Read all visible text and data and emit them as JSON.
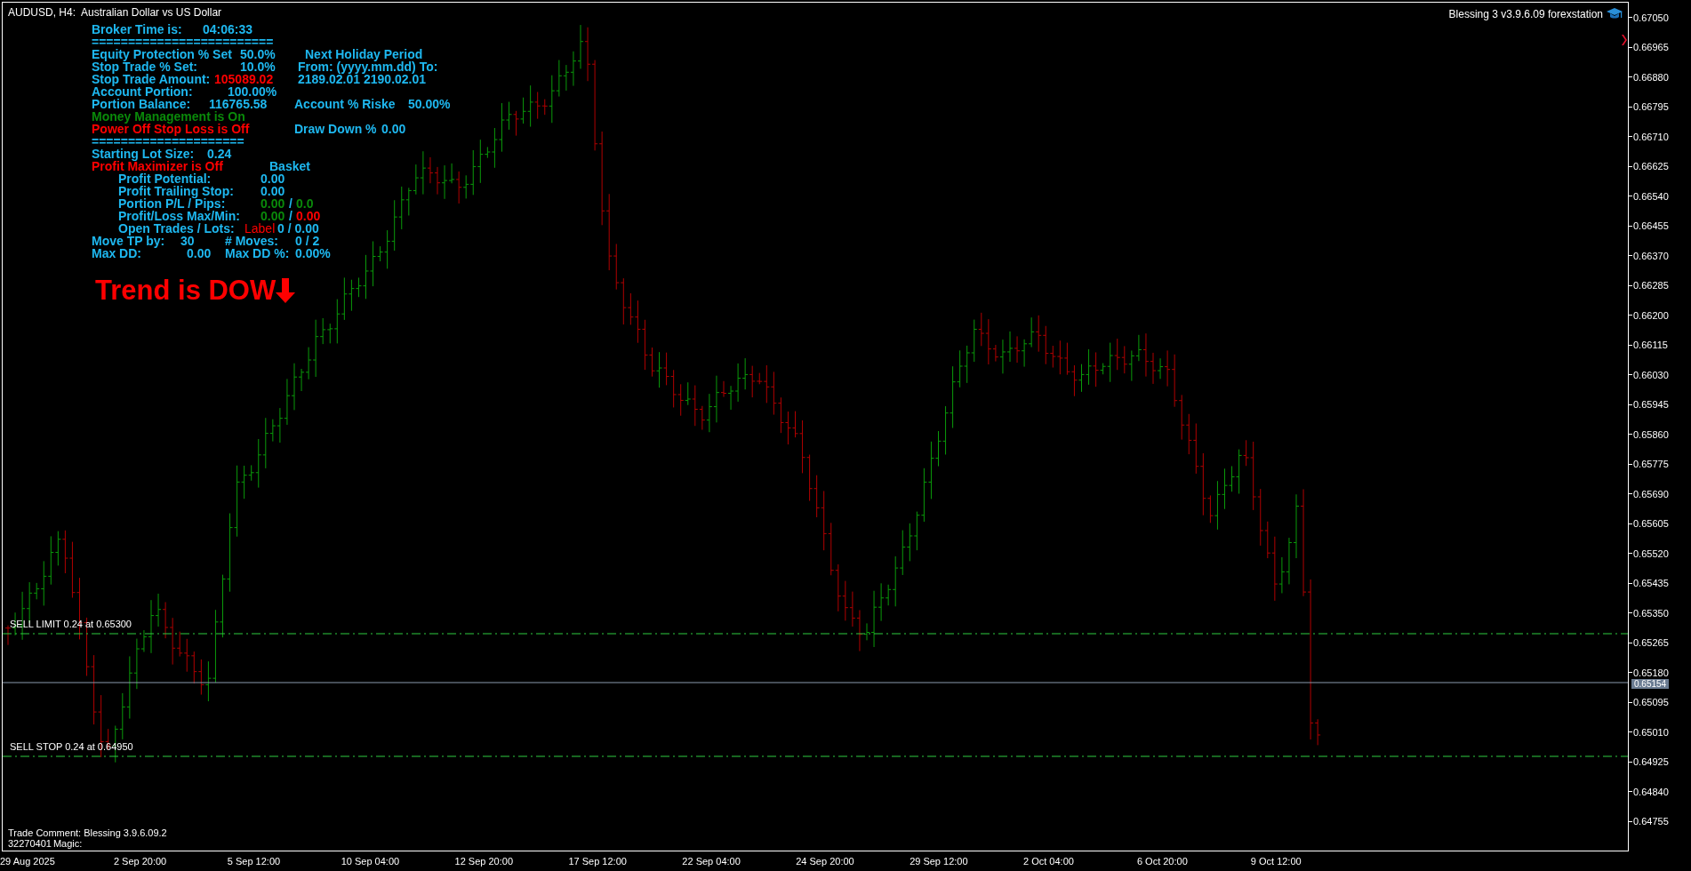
{
  "chart": {
    "symbol_title": "AUDUSD, H4:  Australian Dollar vs US Dollar",
    "expert_title": "Blessing 3 v3.9.6.09 forexstation",
    "price_axis": [
      "0.67050",
      "0.66965",
      "0.66880",
      "0.66795",
      "0.66710",
      "0.66625",
      "0.66540",
      "0.66455",
      "0.66370",
      "0.66285",
      "0.66200",
      "0.66115",
      "0.66030",
      "0.65945",
      "0.65860",
      "0.65775",
      "0.65690",
      "0.65605",
      "0.65520",
      "0.65435",
      "0.65350",
      "0.65265",
      "0.65180",
      "0.65095",
      "0.65010",
      "0.64925",
      "0.64840",
      "0.64755"
    ],
    "current_price": "0.65154",
    "time_axis": [
      "29 Aug 2025",
      "2 Sep 20:00",
      "5 Sep 12:00",
      "10 Sep 04:00",
      "12 Sep 20:00",
      "17 Sep 12:00",
      "22 Sep 04:00",
      "24 Sep 20:00",
      "29 Sep 12:00",
      "2 Oct 04:00",
      "6 Oct 20:00",
      "9 Oct 12:00"
    ],
    "orders": [
      {
        "label": "SELL LIMIT 0.24 at 0.65300"
      },
      {
        "label": "SELL STOP 0.24 at 0.64950"
      }
    ],
    "comment": "Trade Comment: Blessing 3.9.6.09.2",
    "magic_number": "32270401",
    "magic_label": "Magic:"
  },
  "panel": {
    "lines": [
      [
        {
          "text": "Broker Time is:",
          "color": "#1eb8f0",
          "kind": "bold"
        },
        {
          "text": "04:06:33",
          "color": "#1eb8f0",
          "kind": "bold"
        }
      ],
      [
        {
          "text": "=========================",
          "color": "#1eb8f0",
          "kind": "bold"
        }
      ],
      [
        {
          "text": "Equity Protection % Set",
          "color": "#1eb8f0",
          "kind": "bold"
        },
        {
          "text": "50.0%",
          "color": "#1eb8f0",
          "kind": "bold"
        },
        {
          "text": "Next Holiday Period",
          "color": "#1eb8f0",
          "kind": "bold"
        }
      ],
      [
        {
          "text": "Stop Trade % Set:",
          "color": "#1eb8f0",
          "kind": "bold"
        },
        {
          "text": "10.0%",
          "color": "#1eb8f0",
          "kind": "bold"
        },
        {
          "text": "From: (yyyy.mm.dd) To:",
          "color": "#1eb8f0",
          "kind": "bold"
        }
      ],
      [
        {
          "text": "Stop Trade Amount:",
          "color": "#1eb8f0",
          "kind": "bold"
        },
        {
          "text": "105089.02",
          "color": "#ff0000",
          "kind": "bold"
        },
        {
          "text": "2189.02.01",
          "color": "#1eb8f0",
          "kind": "bold"
        },
        {
          "text": "2190.02.01",
          "color": "#1eb8f0",
          "kind": "bold"
        }
      ],
      [
        {
          "text": "Account Portion:",
          "color": "#1eb8f0",
          "kind": "bold"
        },
        {
          "text": "100.00%",
          "color": "#1eb8f0",
          "kind": "bold"
        }
      ],
      [
        {
          "text": "Portion Balance:",
          "color": "#1eb8f0",
          "kind": "bold"
        },
        {
          "text": "116765.58",
          "color": "#1eb8f0",
          "kind": "bold"
        },
        {
          "text": "Account % Riske",
          "color": "#1eb8f0",
          "kind": "bold"
        },
        {
          "text": "50.00%",
          "color": "#1eb8f0",
          "kind": "bold"
        }
      ],
      [
        {
          "text": "Money Management is On",
          "color": "#0a8a0a",
          "kind": "bold"
        }
      ],
      [
        {
          "text": "Power Off Stop Loss is Off",
          "color": "#ff0000",
          "kind": "bold"
        },
        {
          "text": "Draw Down %",
          "color": "#1eb8f0",
          "kind": "bold"
        },
        {
          "text": "0.00",
          "color": "#1eb8f0",
          "kind": "bold"
        }
      ],
      [
        {
          "text": "=====================",
          "color": "#1eb8f0",
          "kind": "bold"
        }
      ],
      [
        {
          "text": "Starting Lot Size:",
          "color": "#1eb8f0",
          "kind": "bold"
        },
        {
          "text": "0.24",
          "color": "#1eb8f0",
          "kind": "bold"
        }
      ],
      [
        {
          "text": "Profit Maximizer is Off",
          "color": "#ff0000",
          "kind": "bold"
        },
        {
          "text": "Basket",
          "color": "#1eb8f0",
          "kind": "bold"
        }
      ],
      [
        {
          "text": "Profit Potential:",
          "color": "#1eb8f0",
          "kind": "bold"
        },
        {
          "text": "0.00",
          "color": "#1eb8f0",
          "kind": "bold"
        }
      ],
      [
        {
          "text": "Profit Trailing Stop:",
          "color": "#1eb8f0",
          "kind": "bold"
        },
        {
          "text": "0.00",
          "color": "#1eb8f0",
          "kind": "bold"
        }
      ],
      [
        {
          "text": "Portion P/L / Pips:",
          "color": "#1eb8f0",
          "kind": "bold"
        },
        {
          "text": "0.00",
          "color": "#0a8a0a",
          "kind": "bold"
        },
        {
          "text": "/",
          "color": "#1eb8f0",
          "kind": "bold"
        },
        {
          "text": "0.0",
          "color": "#0a8a0a",
          "kind": "bold"
        }
      ],
      [
        {
          "text": "Profit/Loss Max/Min:",
          "color": "#1eb8f0",
          "kind": "bold"
        },
        {
          "text": "0.00",
          "color": "#0a8a0a",
          "kind": "bold"
        },
        {
          "text": "/",
          "color": "#1eb8f0",
          "kind": "bold"
        },
        {
          "text": "0.00",
          "color": "#ff0000",
          "kind": "bold"
        }
      ],
      [
        {
          "text": "Open Trades / Lots:",
          "color": "#1eb8f0",
          "kind": "bold"
        },
        {
          "text": "Label",
          "color": "#ff0000",
          "kind": "plain"
        },
        {
          "text": "0 / 0.00",
          "color": "#1eb8f0",
          "kind": "bold"
        }
      ],
      [
        {
          "text": "Move TP by:",
          "color": "#1eb8f0",
          "kind": "bold"
        },
        {
          "text": "30",
          "color": "#1eb8f0",
          "kind": "bold"
        },
        {
          "text": "# Moves:",
          "color": "#1eb8f0",
          "kind": "bold"
        },
        {
          "text": "0 / 2",
          "color": "#1eb8f0",
          "kind": "bold"
        }
      ],
      [
        {
          "text": "Max DD:",
          "color": "#1eb8f0",
          "kind": "bold"
        },
        {
          "text": "0.00",
          "color": "#1eb8f0",
          "kind": "bold"
        },
        {
          "text": "Max DD %:",
          "color": "#1eb8f0",
          "kind": "bold"
        },
        {
          "text": "0.00%",
          "color": "#1eb8f0",
          "kind": "bold"
        }
      ]
    ]
  },
  "trend": {
    "text": "Trend is DOW"
  }
}
